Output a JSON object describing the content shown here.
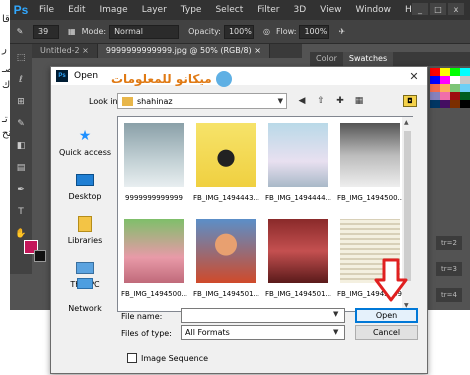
{
  "photoshop": {
    "logo": "Ps",
    "menus": [
      "File",
      "Edit",
      "Image",
      "Layer",
      "Type",
      "Select",
      "Filter",
      "3D",
      "View",
      "Window",
      "Help"
    ],
    "window_buttons": [
      "_",
      "□",
      "x"
    ],
    "options": {
      "brush_size": "39",
      "mode_label": "Mode:",
      "mode_value": "Normal",
      "opacity_label": "Opacity:",
      "opacity_value": "100%",
      "flow_label": "Flow:",
      "flow_value": "100%"
    },
    "doc_tabs": [
      "Untitled-2 ×",
      "9999999999999.jpg @ 50% (RGB/8) ×"
    ],
    "panel_tabs": [
      "Color",
      "Swatches"
    ],
    "layer_rows": [
      "tr=2",
      "tr=3",
      "tr=4"
    ],
    "colors": {
      "foreground": "#c4175a",
      "background": "#111111",
      "accent": "#31a8ff"
    }
  },
  "dialog": {
    "title": "Open",
    "watermark": "ميكانو للمعلومات",
    "look_in_label": "Look in:",
    "look_in_value": "shahinaz",
    "places": [
      {
        "label": "Quick access",
        "icon": "star-icon"
      },
      {
        "label": "Desktop",
        "icon": "desktop-icon"
      },
      {
        "label": "Libraries",
        "icon": "libraries-icon"
      },
      {
        "label": "This PC",
        "icon": "computer-icon"
      },
      {
        "label": "Network",
        "icon": "network-icon"
      }
    ],
    "files": [
      {
        "name": "9999999999999"
      },
      {
        "name": "FB_IMG_1494443..."
      },
      {
        "name": "FB_IMG_1494444..."
      },
      {
        "name": "FB_IMG_1494500..."
      },
      {
        "name": "FB_IMG_1494500..."
      },
      {
        "name": "FB_IMG_1494501..."
      },
      {
        "name": "FB_IMG_1494501..."
      },
      {
        "name": "FB_IMG_14945009..."
      }
    ],
    "file_name_label": "File name:",
    "file_name_value": "",
    "files_of_type_label": "Files of type:",
    "files_of_type_value": "All Formats",
    "open_label": "Open",
    "cancel_label": "Cancel",
    "image_sequence_label": "Image Sequence"
  }
}
